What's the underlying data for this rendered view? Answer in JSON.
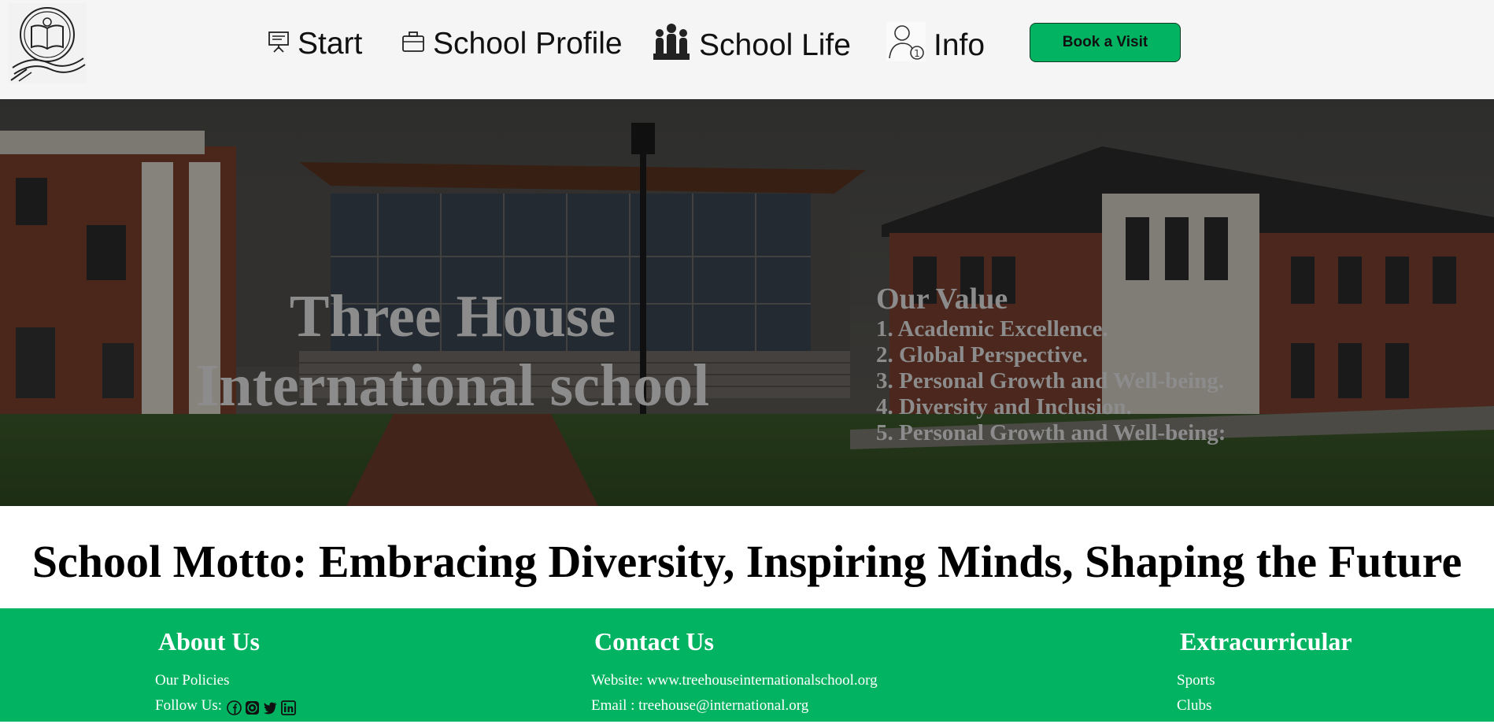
{
  "header": {
    "logo_icon": "book-logo-icon",
    "nav": [
      {
        "label": "Start",
        "icon": "presentation-icon"
      },
      {
        "label": "School Profile",
        "icon": "briefcase-icon"
      },
      {
        "label": "School Life",
        "icon": "people-group-icon"
      },
      {
        "label": "Info",
        "icon": "user-info-icon"
      }
    ],
    "book_button": "Book a Visit"
  },
  "hero": {
    "title_line1": "Three House",
    "title_line2": "International school",
    "value_title": "Our Value",
    "values": [
      "1. Academic Excellence.",
      "2. Global Perspective.",
      "3. Personal Growth and Well-being.",
      "4. Diversity and Inclusion.",
      "5. Personal Growth and Well-being:"
    ]
  },
  "motto": "School Motto: Embracing Diversity, Inspiring Minds, Shaping the Future",
  "footer": {
    "about": {
      "title": "About Us",
      "policies": "Our Policies",
      "follow": "Follow Us:",
      "social_icons": [
        "facebook-icon",
        "whatsapp-icon",
        "twitter-icon",
        "linkedin-icon"
      ]
    },
    "contact": {
      "title": "Contact Us",
      "website": "Website: www.treehouseinternationalschool.org",
      "email": "Email : treehouse@international.org"
    },
    "extracurricular": {
      "title": "Extracurricular",
      "items": [
        "Sports",
        "Clubs"
      ]
    }
  },
  "colors": {
    "accent_green": "#02b462",
    "header_bg": "#f5f5f5",
    "hero_text": "#8c8c8c"
  }
}
